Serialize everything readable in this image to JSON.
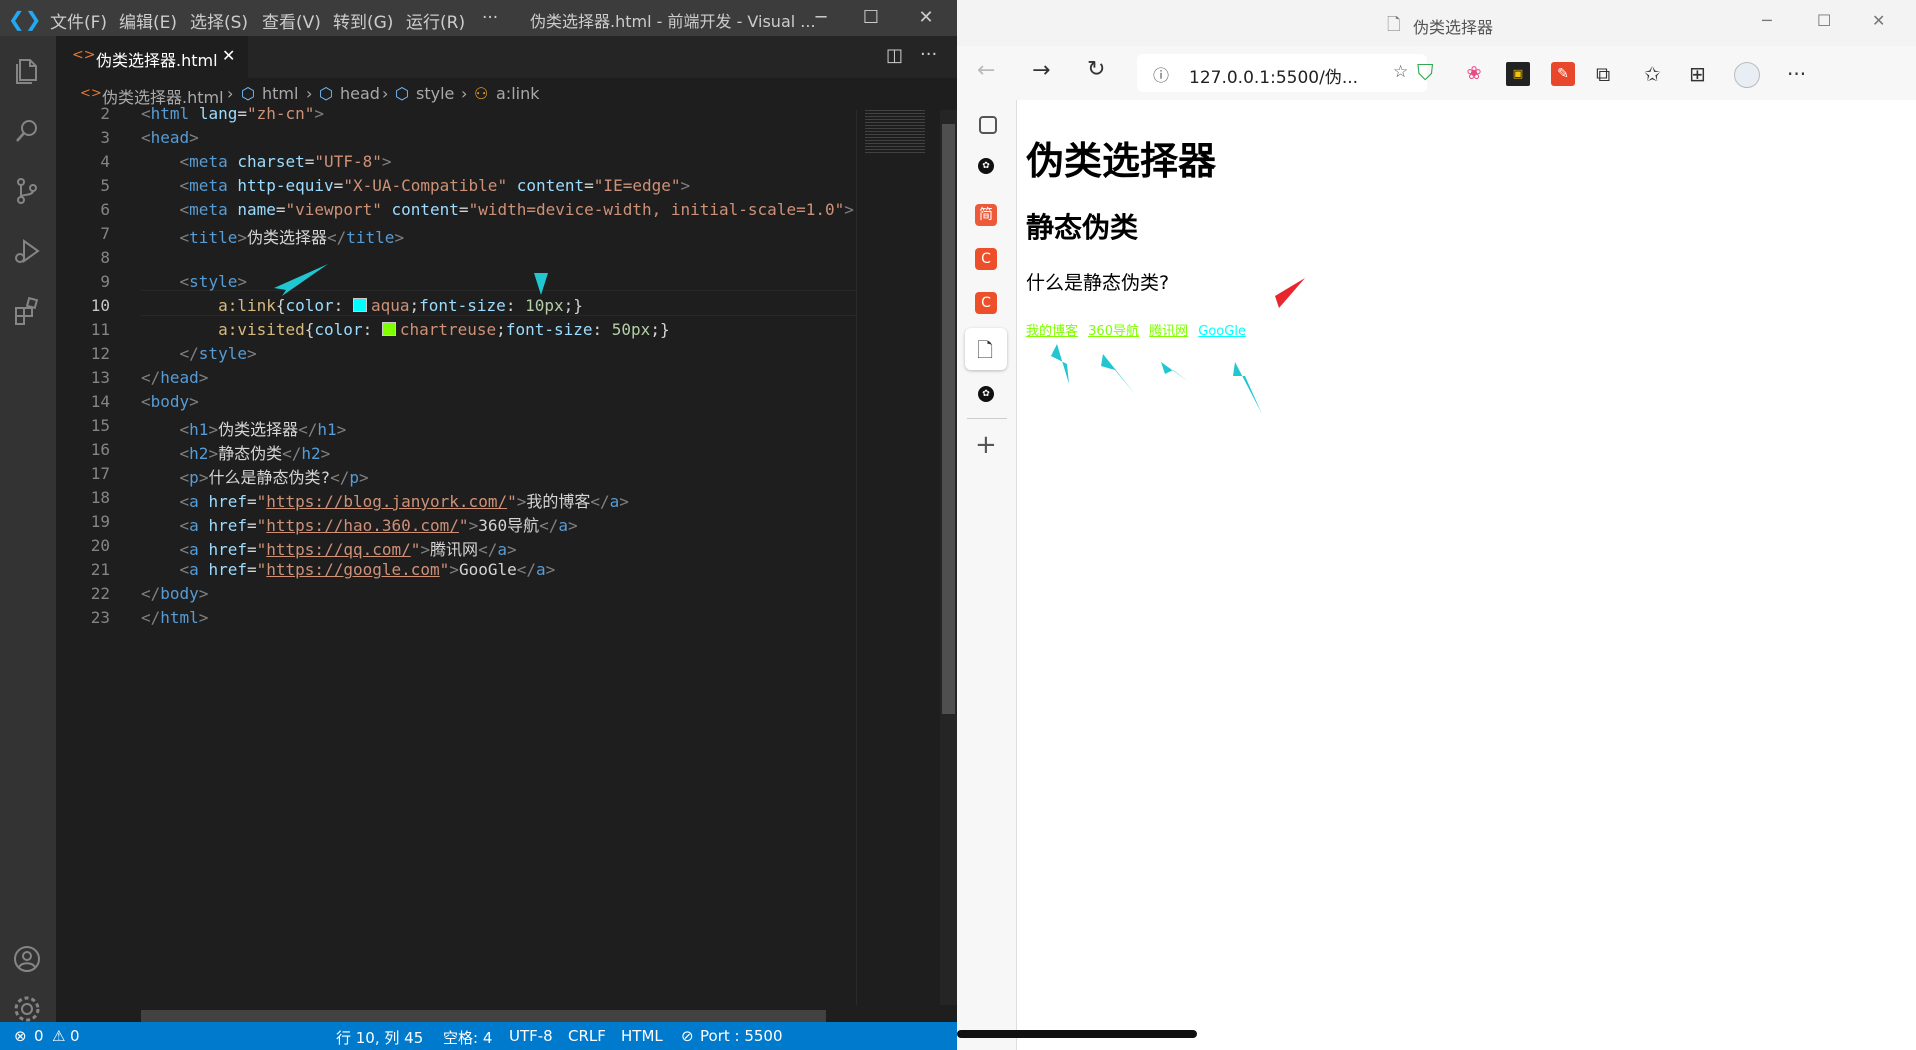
{
  "vscode": {
    "menus": [
      "文件(F)",
      "编辑(E)",
      "选择(S)",
      "查看(V)",
      "转到(G)",
      "运行(R)",
      "···"
    ],
    "window_title": "伪类选择器.html - 前端开发 - Visual ...",
    "tab_label": "伪类选择器.html",
    "breadcrumb": [
      "伪类选择器.html",
      "html",
      "head",
      "style",
      "a:link"
    ],
    "line_numbers": [
      "2",
      "3",
      "4",
      "5",
      "6",
      "7",
      "8",
      "9",
      "10",
      "11",
      "12",
      "13",
      "14",
      "15",
      "16",
      "17",
      "18",
      "19",
      "20",
      "21",
      "22",
      "23"
    ],
    "code": {
      "l4_attr": "charset",
      "l4_val": "\"UTF-8\"",
      "l5_val1": "\"X-UA-Compatible\"",
      "l5_val2": "\"IE=edge\"",
      "l6_val1": "\"viewport\"",
      "l6_val2": "\"width=device-width, initial-scale=1.0\"",
      "l7_text": "伪类选择器",
      "l10_sel": "a:link",
      "l10_prop1": "color",
      "l10_color": "aqua",
      "l10_prop2": "font-size",
      "l10_size": "10px",
      "l11_sel": "a:visited",
      "l11_prop1": "color",
      "l11_color": "chartreuse",
      "l11_prop2": "font-size",
      "l11_size": "50px",
      "l15_text": "伪类选择器",
      "l16_text": "静态伪类",
      "l17_text": "什么是静态伪类?",
      "l18_href": "https://blog.janyork.com/",
      "l18_text": "我的博客",
      "l19_href": "https://hao.360.com/",
      "l19_text": "360导航",
      "l20_href": "https://qq.com/",
      "l20_text": "腾讯网",
      "l21_href": "https://google.com",
      "l21_text": "GooGle"
    },
    "status": {
      "errors": "0",
      "warnings": "0",
      "position": "行 10, 列 45",
      "spaces": "空格: 4",
      "encoding": "UTF-8",
      "eol": "CRLF",
      "language": "HTML",
      "port": "Port : 5500"
    },
    "colors": {
      "aqua": "#00ffff",
      "chartreuse": "#7fff00",
      "accent": "#007acc"
    }
  },
  "browser": {
    "tab_title": "伪类选择器",
    "address": "127.0.0.1:5500/伪...",
    "page": {
      "h1": "伪类选择器",
      "h2": "静态伪类",
      "p": "什么是静态伪类?",
      "links": [
        "我的博客",
        "360导航",
        "腾讯网",
        "GooGle"
      ]
    },
    "sidebar_icons": [
      "tabs-icon",
      "extension-icon",
      "jian-icon",
      "csdn-icon",
      "csdn-icon",
      "page-icon",
      "extension-icon",
      "add-icon"
    ]
  }
}
